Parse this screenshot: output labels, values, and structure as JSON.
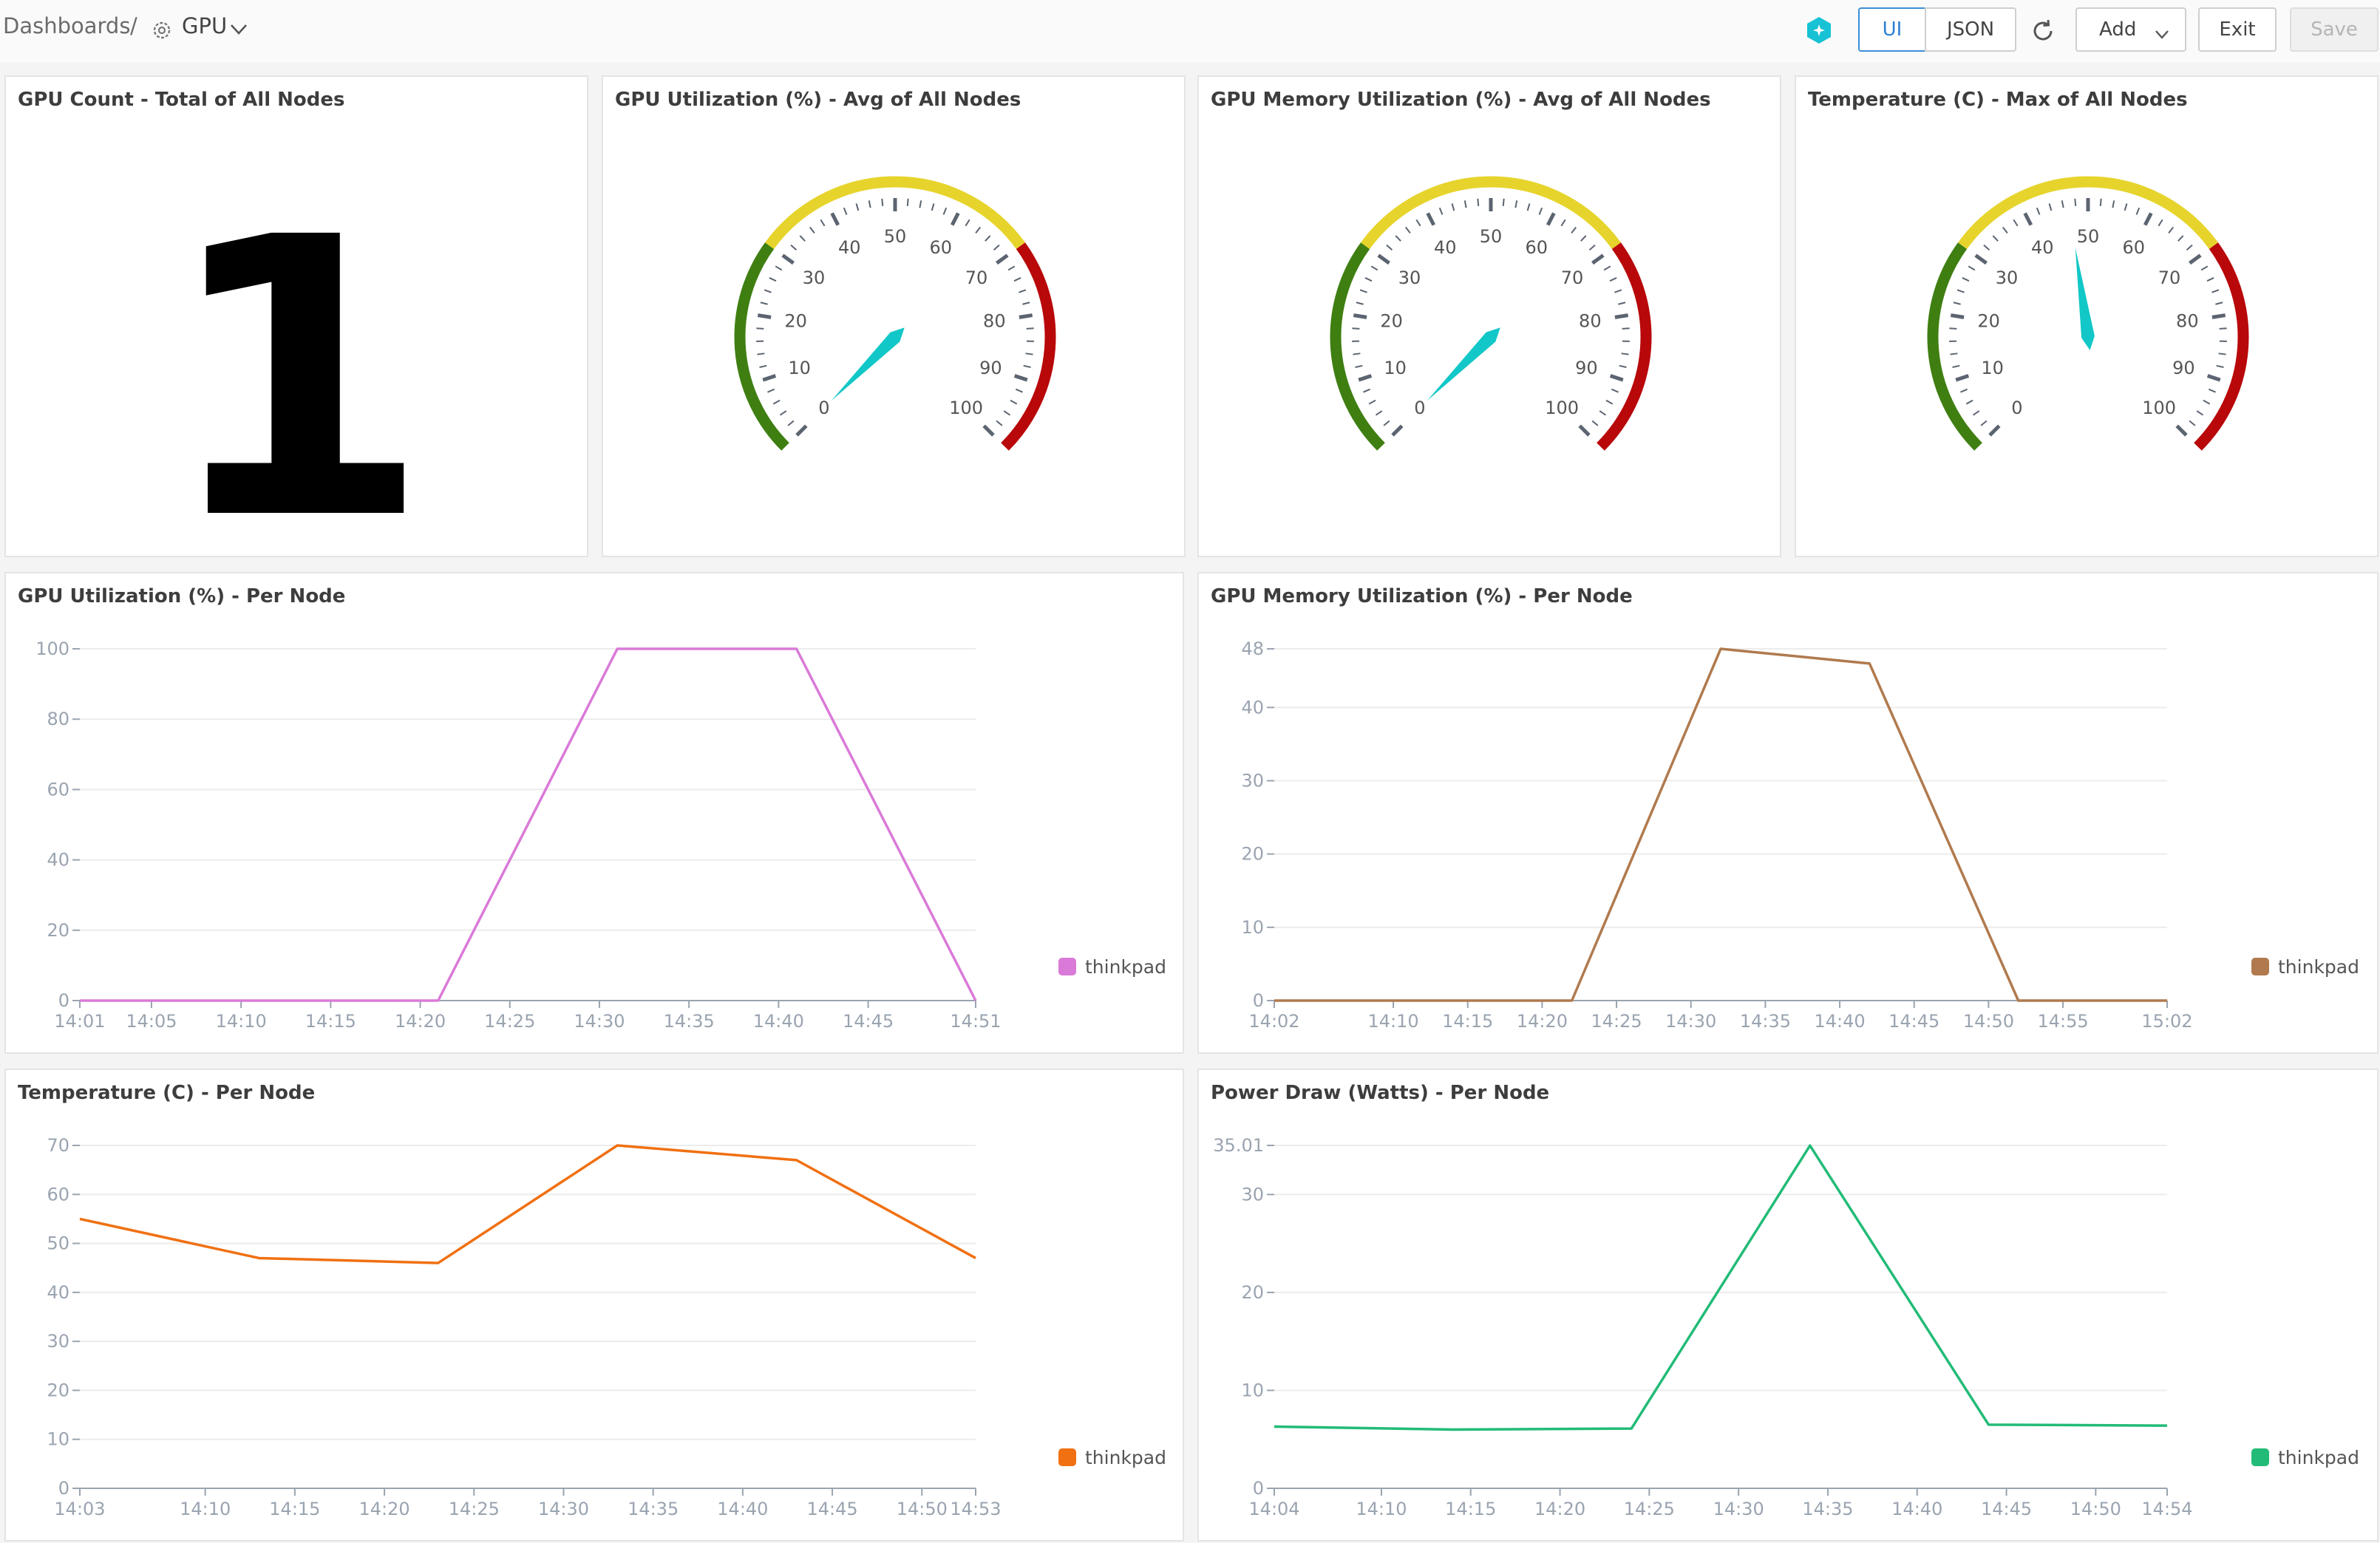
{
  "breadcrumb": {
    "root": "Dashboards",
    "separator": "/",
    "current": "GPU"
  },
  "toolbar": {
    "ui_label": "UI",
    "json_label": "JSON",
    "add_label": "Add",
    "exit_label": "Exit",
    "save_label": "Save"
  },
  "colors": {
    "gauge_green": "#3f7f12",
    "gauge_yellow": "#e6d42c",
    "gauge_red": "#b8080a",
    "needle": "#12c7c7"
  },
  "stat": {
    "title": "GPU Count - Total of All Nodes",
    "value": "1"
  },
  "gauges": [
    {
      "title": "GPU Utilization (%) - Avg of All Nodes",
      "value": 0,
      "ticks": [
        "0",
        "10",
        "20",
        "30",
        "40",
        "50",
        "60",
        "70",
        "80",
        "90",
        "100"
      ]
    },
    {
      "title": "GPU Memory Utilization (%) - Avg of All Nodes",
      "value": 0,
      "ticks": [
        "0",
        "10",
        "20",
        "30",
        "40",
        "50",
        "60",
        "70",
        "80",
        "90",
        "100"
      ]
    },
    {
      "title": "Temperature (C) - Max of All Nodes",
      "value": 47,
      "ticks": [
        "0",
        "10",
        "20",
        "30",
        "40",
        "50",
        "60",
        "70",
        "80",
        "90",
        "100"
      ]
    }
  ],
  "chart_data": [
    {
      "type": "line",
      "title": "GPU Utilization (%) - Per Node",
      "color": "#da7ad8",
      "x_ticks": [
        "14:01",
        "14:05",
        "14:10",
        "14:15",
        "14:20",
        "14:25",
        "14:30",
        "14:35",
        "14:40",
        "14:45",
        "14:51"
      ],
      "x_tick_pos": [
        0,
        4,
        9,
        14,
        19,
        24,
        29,
        34,
        39,
        44,
        50
      ],
      "x_range": [
        0,
        50
      ],
      "y_ticks": [
        "0",
        "20",
        "40",
        "60",
        "80",
        "100"
      ],
      "y_tick_vals": [
        0,
        20,
        40,
        60,
        80,
        100
      ],
      "ylim": [
        0,
        100
      ],
      "series": [
        {
          "name": "thinkpad",
          "x": [
            0,
            10,
            20,
            30,
            40,
            50
          ],
          "values": [
            0,
            0,
            0,
            100,
            100,
            0
          ]
        }
      ]
    },
    {
      "type": "line",
      "title": "GPU Memory Utilization (%) - Per Node",
      "color": "#b07a4e",
      "x_ticks": [
        "14:02",
        "14:10",
        "14:15",
        "14:20",
        "14:25",
        "14:30",
        "14:35",
        "14:40",
        "14:45",
        "14:50",
        "14:55",
        "15:02"
      ],
      "x_tick_pos": [
        0,
        8,
        13,
        18,
        23,
        28,
        33,
        38,
        43,
        48,
        53,
        60
      ],
      "x_range": [
        0,
        60
      ],
      "y_ticks": [
        "0",
        "10",
        "20",
        "30",
        "40",
        "48"
      ],
      "y_tick_vals": [
        0,
        10,
        20,
        30,
        40,
        48
      ],
      "ylim": [
        0,
        48
      ],
      "series": [
        {
          "name": "thinkpad",
          "x": [
            0,
            10,
            20,
            30,
            40,
            50,
            60
          ],
          "values": [
            0,
            0,
            0,
            48,
            46,
            0,
            0
          ]
        }
      ]
    },
    {
      "type": "line",
      "title": "Temperature (C) - Per Node",
      "color": "#f07012",
      "x_ticks": [
        "14:03",
        "14:10",
        "14:15",
        "14:20",
        "14:25",
        "14:30",
        "14:35",
        "14:40",
        "14:45",
        "14:50",
        "14:53"
      ],
      "x_tick_pos": [
        0,
        7,
        12,
        17,
        22,
        27,
        32,
        37,
        42,
        47,
        50
      ],
      "x_range": [
        0,
        50
      ],
      "y_ticks": [
        "0",
        "10",
        "20",
        "30",
        "40",
        "50",
        "60",
        "70"
      ],
      "y_tick_vals": [
        0,
        10,
        20,
        30,
        40,
        50,
        60,
        70
      ],
      "ylim": [
        0,
        70
      ],
      "series": [
        {
          "name": "thinkpad",
          "x": [
            0,
            10,
            20,
            30,
            40,
            50
          ],
          "values": [
            55,
            47,
            46,
            70,
            67,
            47
          ]
        }
      ]
    },
    {
      "type": "line",
      "title": "Power Draw (Watts) - Per Node",
      "color": "#22bb77",
      "x_ticks": [
        "14:04",
        "14:10",
        "14:15",
        "14:20",
        "14:25",
        "14:30",
        "14:35",
        "14:40",
        "14:45",
        "14:50",
        "14:54"
      ],
      "x_tick_pos": [
        0,
        6,
        11,
        16,
        21,
        26,
        31,
        36,
        41,
        46,
        50
      ],
      "x_range": [
        0,
        50
      ],
      "y_ticks": [
        "0",
        "10",
        "20",
        "30",
        "35.01"
      ],
      "y_tick_vals": [
        0,
        10,
        20,
        30,
        35.01
      ],
      "ylim": [
        0,
        35.01
      ],
      "series": [
        {
          "name": "thinkpad",
          "x": [
            0,
            10,
            20,
            30,
            40,
            50
          ],
          "values": [
            6.3,
            6,
            6.1,
            35,
            6.5,
            6.4
          ]
        }
      ]
    }
  ]
}
